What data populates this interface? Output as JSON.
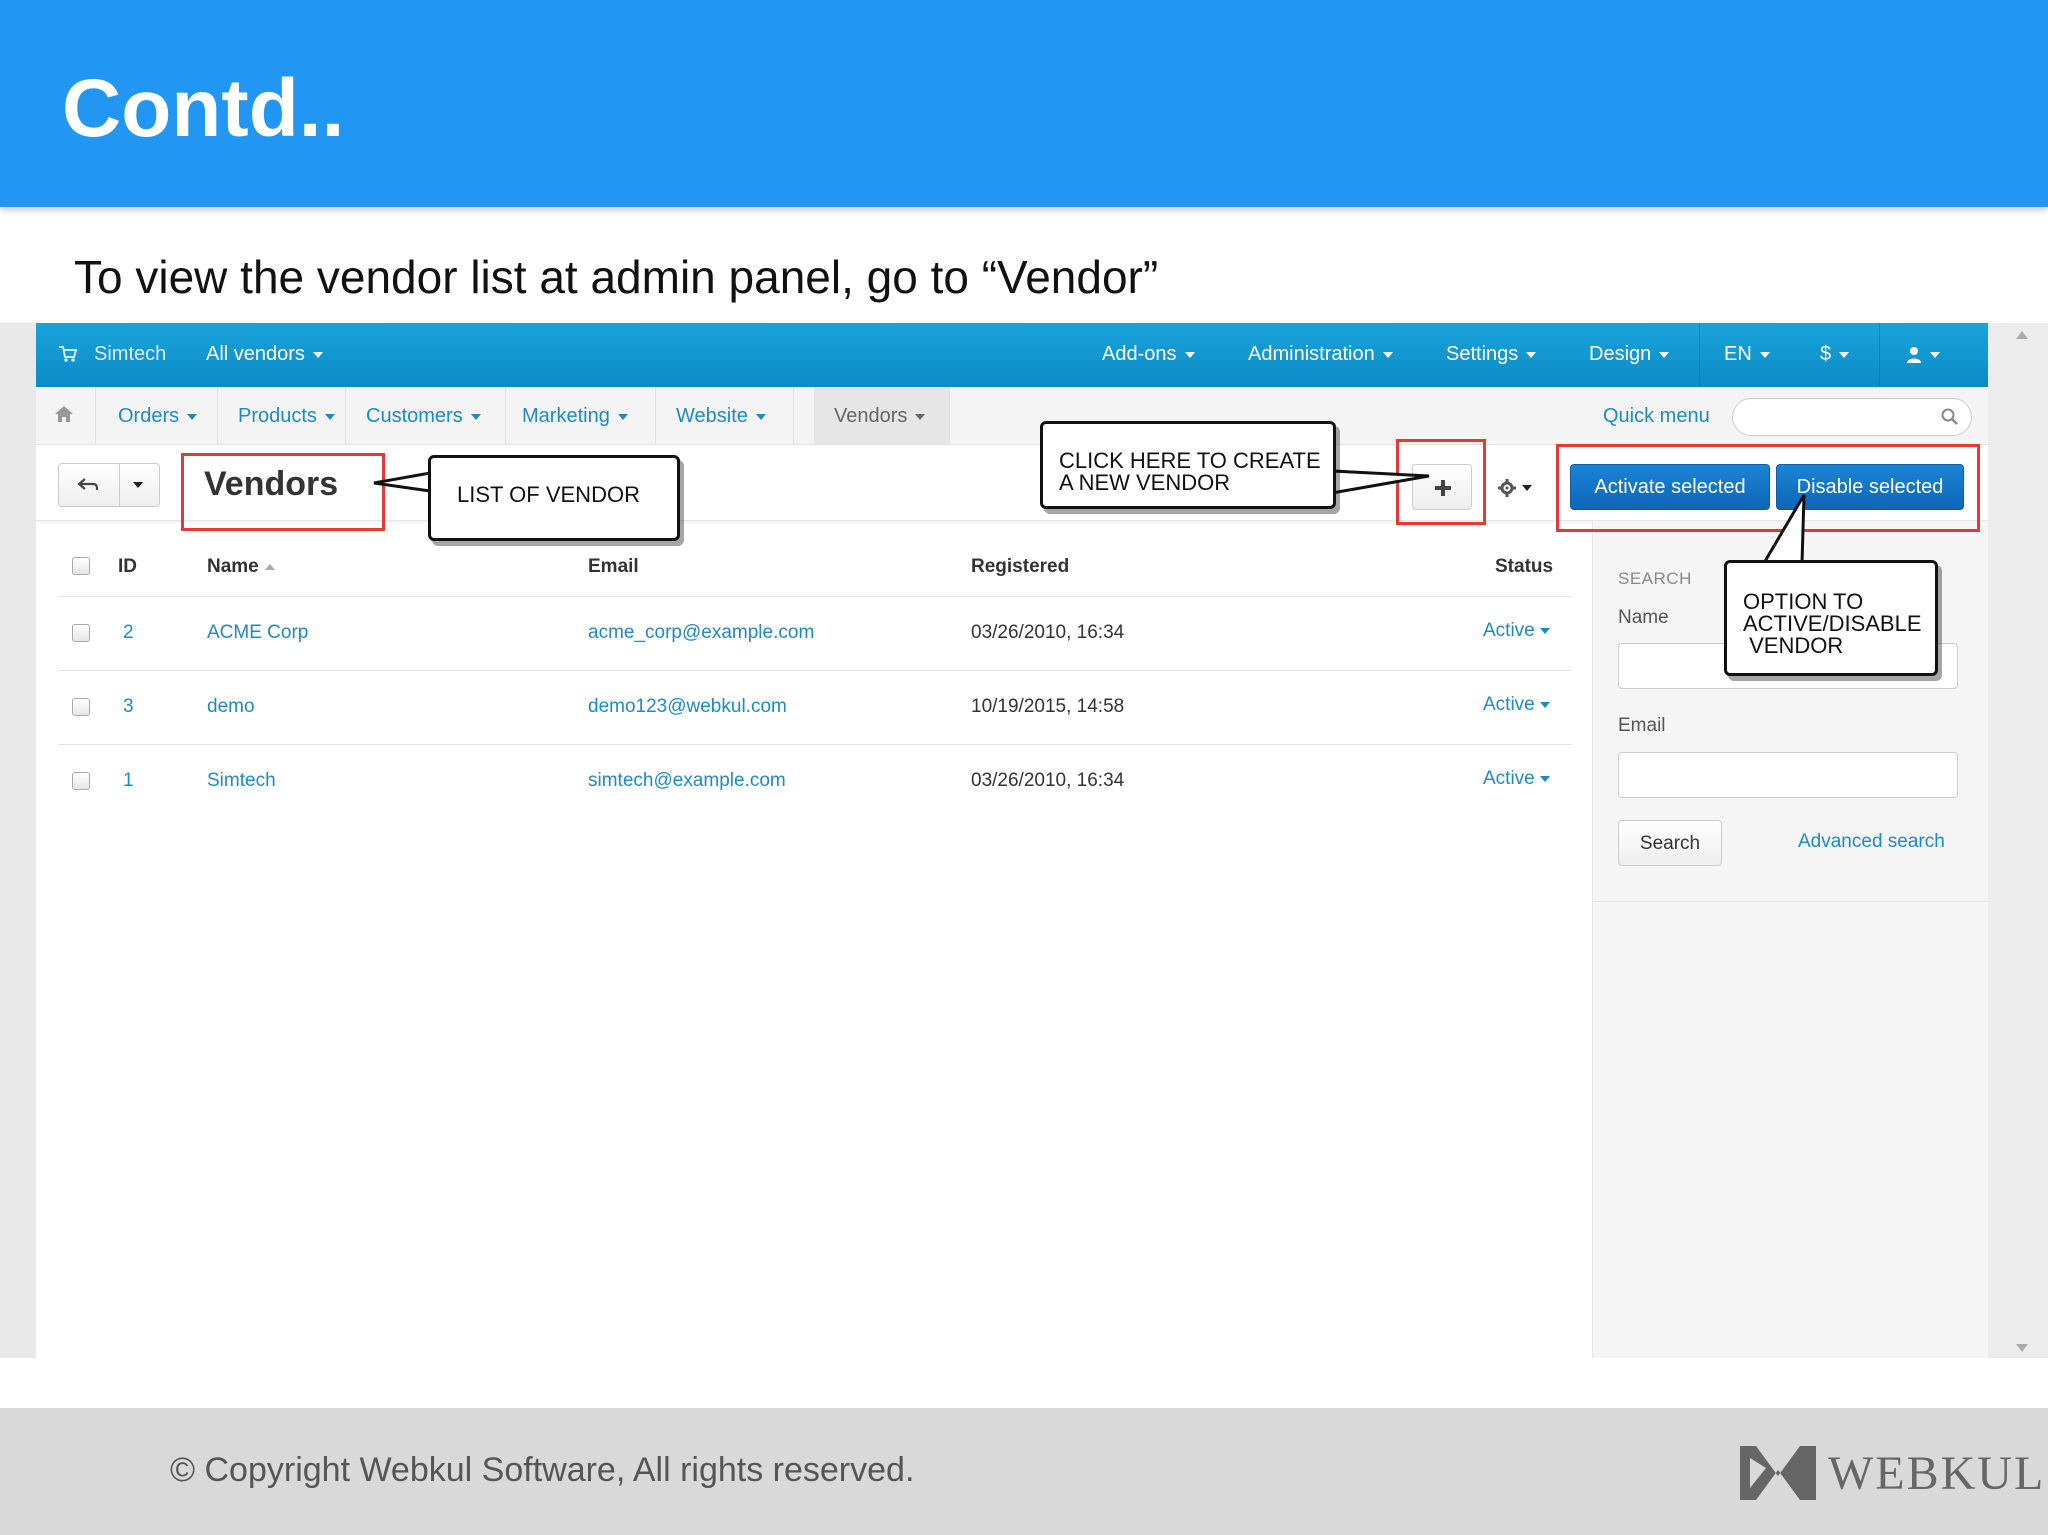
{
  "slide": {
    "title": "Contd..",
    "subtitle": "To view the vendor list at admin panel, go to “Vendor”",
    "copyright": "© Copyright Webkul Software, All rights reserved.",
    "logo_text": "WEBKUL"
  },
  "topnav": {
    "store": "Simtech",
    "vendors_dropdown": "All vendors",
    "items": [
      "Add-ons",
      "Administration",
      "Settings",
      "Design",
      "EN",
      "$"
    ]
  },
  "subnav": {
    "tabs": [
      "Orders",
      "Products",
      "Customers",
      "Marketing",
      "Website",
      "Vendors"
    ],
    "active_tab": "Vendors",
    "quick_menu": "Quick menu"
  },
  "toolbar": {
    "page_title": "Vendors",
    "add_icon": "plus-icon",
    "settings_icon": "gear-icon",
    "activate_label": "Activate selected",
    "disable_label": "Disable selected"
  },
  "table": {
    "headers": [
      "ID",
      "Name",
      "Email",
      "Registered",
      "Status"
    ],
    "rows": [
      {
        "id": "2",
        "name": "ACME Corp",
        "email": "acme_corp@example.com",
        "registered": "03/26/2010, 16:34",
        "status": "Active"
      },
      {
        "id": "3",
        "name": "demo",
        "email": "demo123@webkul.com",
        "registered": "10/19/2015, 14:58",
        "status": "Active"
      },
      {
        "id": "1",
        "name": "Simtech",
        "email": "simtech@example.com",
        "registered": "03/26/2010, 16:34",
        "status": "Active"
      }
    ]
  },
  "sidebar": {
    "heading": "SEARCH",
    "name_label": "Name",
    "email_label": "Email",
    "search_button": "Search",
    "advanced_search": "Advanced search"
  },
  "annotations": {
    "list_of_vendor": "LIST OF VENDOR",
    "create_vendor": [
      "CLICK HERE TO CREATE",
      "A NEW VENDOR"
    ],
    "activate_disable": [
      "OPTION TO",
      "ACTIVE/DISABLE",
      " VENDOR"
    ]
  },
  "colors": {
    "slide_header": "#2196f3",
    "topnav": "#0f95cf",
    "link": "#1f8ac2",
    "primary_button": "#0f66b6",
    "annotation_box": "#e53935"
  }
}
